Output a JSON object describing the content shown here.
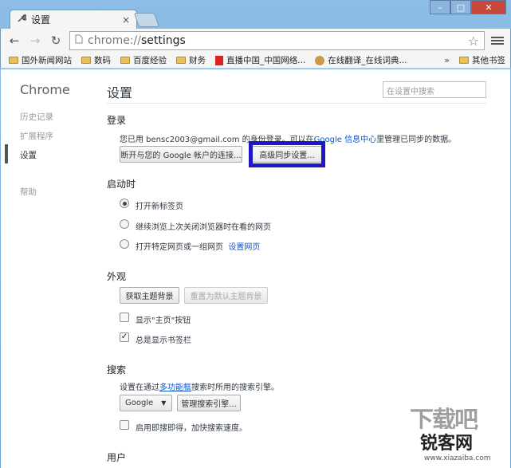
{
  "window": {
    "tab_title": "设置"
  },
  "toolbar": {
    "url_scheme": "chrome://",
    "url_path": "settings"
  },
  "bookmarks": {
    "items": [
      "国外新闻网站",
      "数码",
      "百度经验",
      "财务",
      "直播中国_中国网络...",
      "在线翻译_在线词典..."
    ],
    "more": "»",
    "other": "其他书签"
  },
  "sidebar": {
    "brand": "Chrome",
    "items": [
      "历史记录",
      "扩展程序",
      "设置",
      "帮助"
    ]
  },
  "main": {
    "title": "设置",
    "search_placeholder": "在设置中搜索",
    "signin": {
      "heading": "登录",
      "text_before": "您已用 bensc2003@gmail.com 的身份登录。可以在",
      "link": "Google 信息中心",
      "text_after": "里管理已同步的数据。",
      "disconnect_button": "断开与您的 Google 帐户的连接...",
      "advanced_sync_button": "高级同步设置..."
    },
    "startup": {
      "heading": "启动时",
      "options": [
        "打开新标签页",
        "继续浏览上次关闭浏览器时在看的网页",
        "打开特定网页或一组网页"
      ],
      "set_pages_link": "设置网页"
    },
    "appearance": {
      "heading": "外观",
      "get_themes_button": "获取主题背景",
      "reset_theme_button": "重置为默认主题背景",
      "show_home_label": "显示\"主页\"按钮",
      "show_bookmarks_label": "总是显示书签栏"
    },
    "search": {
      "heading": "搜索",
      "text_before": "设置在通过",
      "link": "多功能框",
      "text_after": "搜索时所用的搜索引擎。",
      "engine_selected": "Google",
      "manage_button": "管理搜索引擎...",
      "instant_label": "启用即搜即得，加快搜索速度。"
    },
    "users": {
      "heading": "用户"
    }
  },
  "watermark": {
    "big": "下载吧",
    "site": "锐客网",
    "url": "www.xiazaiba.com"
  },
  "colors": {
    "highlight_box": "#1d17c8",
    "link": "#1155cc",
    "titlebar": "#6ba6d8"
  }
}
